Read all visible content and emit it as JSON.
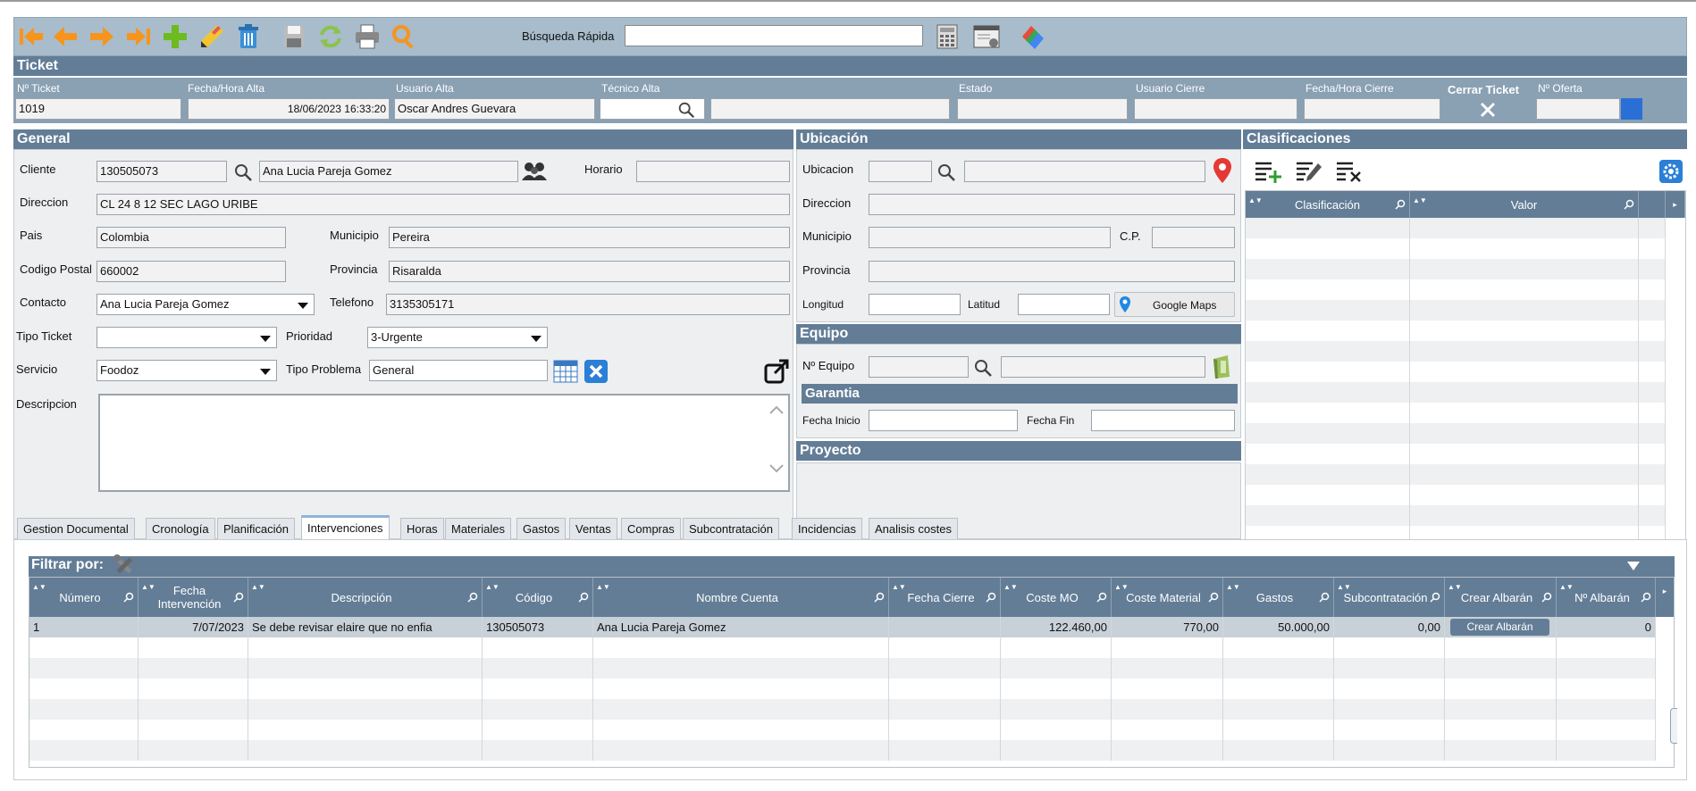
{
  "toolbar": {
    "search_label": "Búsqueda Rápida",
    "search_value": "",
    "buttons": [
      "first-icon",
      "prev-icon",
      "next-icon",
      "last-icon",
      "add-icon",
      "edit-icon",
      "delete-icon",
      "save-icon",
      "refresh-icon",
      "print-icon",
      "search-icon",
      "calculator-icon",
      "window-icon",
      "tags-icon"
    ]
  },
  "ticket": {
    "title": "Ticket",
    "fields": {
      "numero_label": "Nº Ticket",
      "numero": "1019",
      "fecha_alta_label": "Fecha/Hora Alta",
      "fecha_alta": "18/06/2023 16:33:20",
      "usuario_alta_label": "Usuario Alta",
      "usuario_alta": "Oscar Andres Guevara",
      "tecnico_alta_label": "Técnico Alta",
      "tecnico_alta": "",
      "estado_label": "Estado",
      "estado": "",
      "usuario_cierre_label": "Usuario Cierre",
      "usuario_cierre": "",
      "fecha_cierre_label": "Fecha/Hora Cierre",
      "fecha_cierre": "",
      "cerrar_label": "Cerrar Ticket",
      "oferta_label": "Nº Oferta",
      "oferta": ""
    }
  },
  "general": {
    "title": "General",
    "cliente_label": "Cliente",
    "cliente_code": "130505073",
    "cliente_name": "Ana Lucia Pareja Gomez",
    "horario_label": "Horario",
    "horario": "",
    "direccion_label": "Direccion",
    "direccion": "CL 24 8 12 SEC LAGO URIBE",
    "pais_label": "Pais",
    "pais": "Colombia",
    "municipio_label": "Municipio",
    "municipio": "Pereira",
    "cp_label": "Codigo Postal",
    "cp": "660002",
    "provincia_label": "Provincia",
    "provincia": "Risaralda",
    "contacto_label": "Contacto",
    "contacto": "Ana Lucia Pareja Gomez",
    "telefono_label": "Telefono",
    "telefono": "3135305171",
    "tipo_ticket_label": "Tipo Ticket",
    "tipo_ticket": "",
    "prioridad_label": "Prioridad",
    "prioridad": "3-Urgente",
    "servicio_label": "Servicio",
    "servicio": "Foodoz",
    "tipo_problema_label": "Tipo Problema",
    "tipo_problema": "General",
    "descripcion_label": "Descripcion",
    "descripcion": ""
  },
  "ubicacion": {
    "title": "Ubicación",
    "ubicacion_label": "Ubicacion",
    "direccion_label": "Direccion",
    "municipio_label": "Municipio",
    "cp_label": "C.P.",
    "provincia_label": "Provincia",
    "longitud_label": "Longitud",
    "latitud_label": "Latitud",
    "maps_label": "Google Maps"
  },
  "equipo": {
    "title": "Equipo",
    "numero_label": "Nº Equipo",
    "garantia_title": "Garantia",
    "fecha_inicio_label": "Fecha Inicio",
    "fecha_fin_label": "Fecha Fin"
  },
  "proyecto": {
    "title": "Proyecto"
  },
  "clasificaciones": {
    "title": "Clasificaciones",
    "col_clasificacion": "Clasificación",
    "col_valor": "Valor"
  },
  "tabs": [
    "Gestion Documental",
    "Cronología",
    "Planificación",
    "Intervenciones",
    "Horas",
    "Materiales",
    "Gastos",
    "Ventas",
    "Compras",
    "Subcontratación",
    "Incidencias",
    "Analisis costes"
  ],
  "active_tab": "Intervenciones",
  "filter": {
    "label": "Filtrar por:"
  },
  "table": {
    "headers": [
      "Número",
      "Fecha Intervención",
      "Descripción",
      "Código",
      "Nombre Cuenta",
      "Fecha Cierre",
      "Coste MO",
      "Coste Material",
      "Gastos",
      "Subcontratación",
      "Crear Albarán",
      "Nº Albarán"
    ],
    "rows": [
      {
        "numero": "1",
        "fecha": "7/07/2023",
        "descripcion": "Se debe revisar elaire que no enfia",
        "codigo": "130505073",
        "nombre": "Ana Lucia Pareja Gomez",
        "fecha_cierre": "",
        "coste_mo": "122.460,00",
        "coste_material": "770,00",
        "gastos": "50.000,00",
        "subcontratacion": "0,00",
        "crear_albaran": "Crear Albarán",
        "num_albaran": "0"
      }
    ]
  }
}
